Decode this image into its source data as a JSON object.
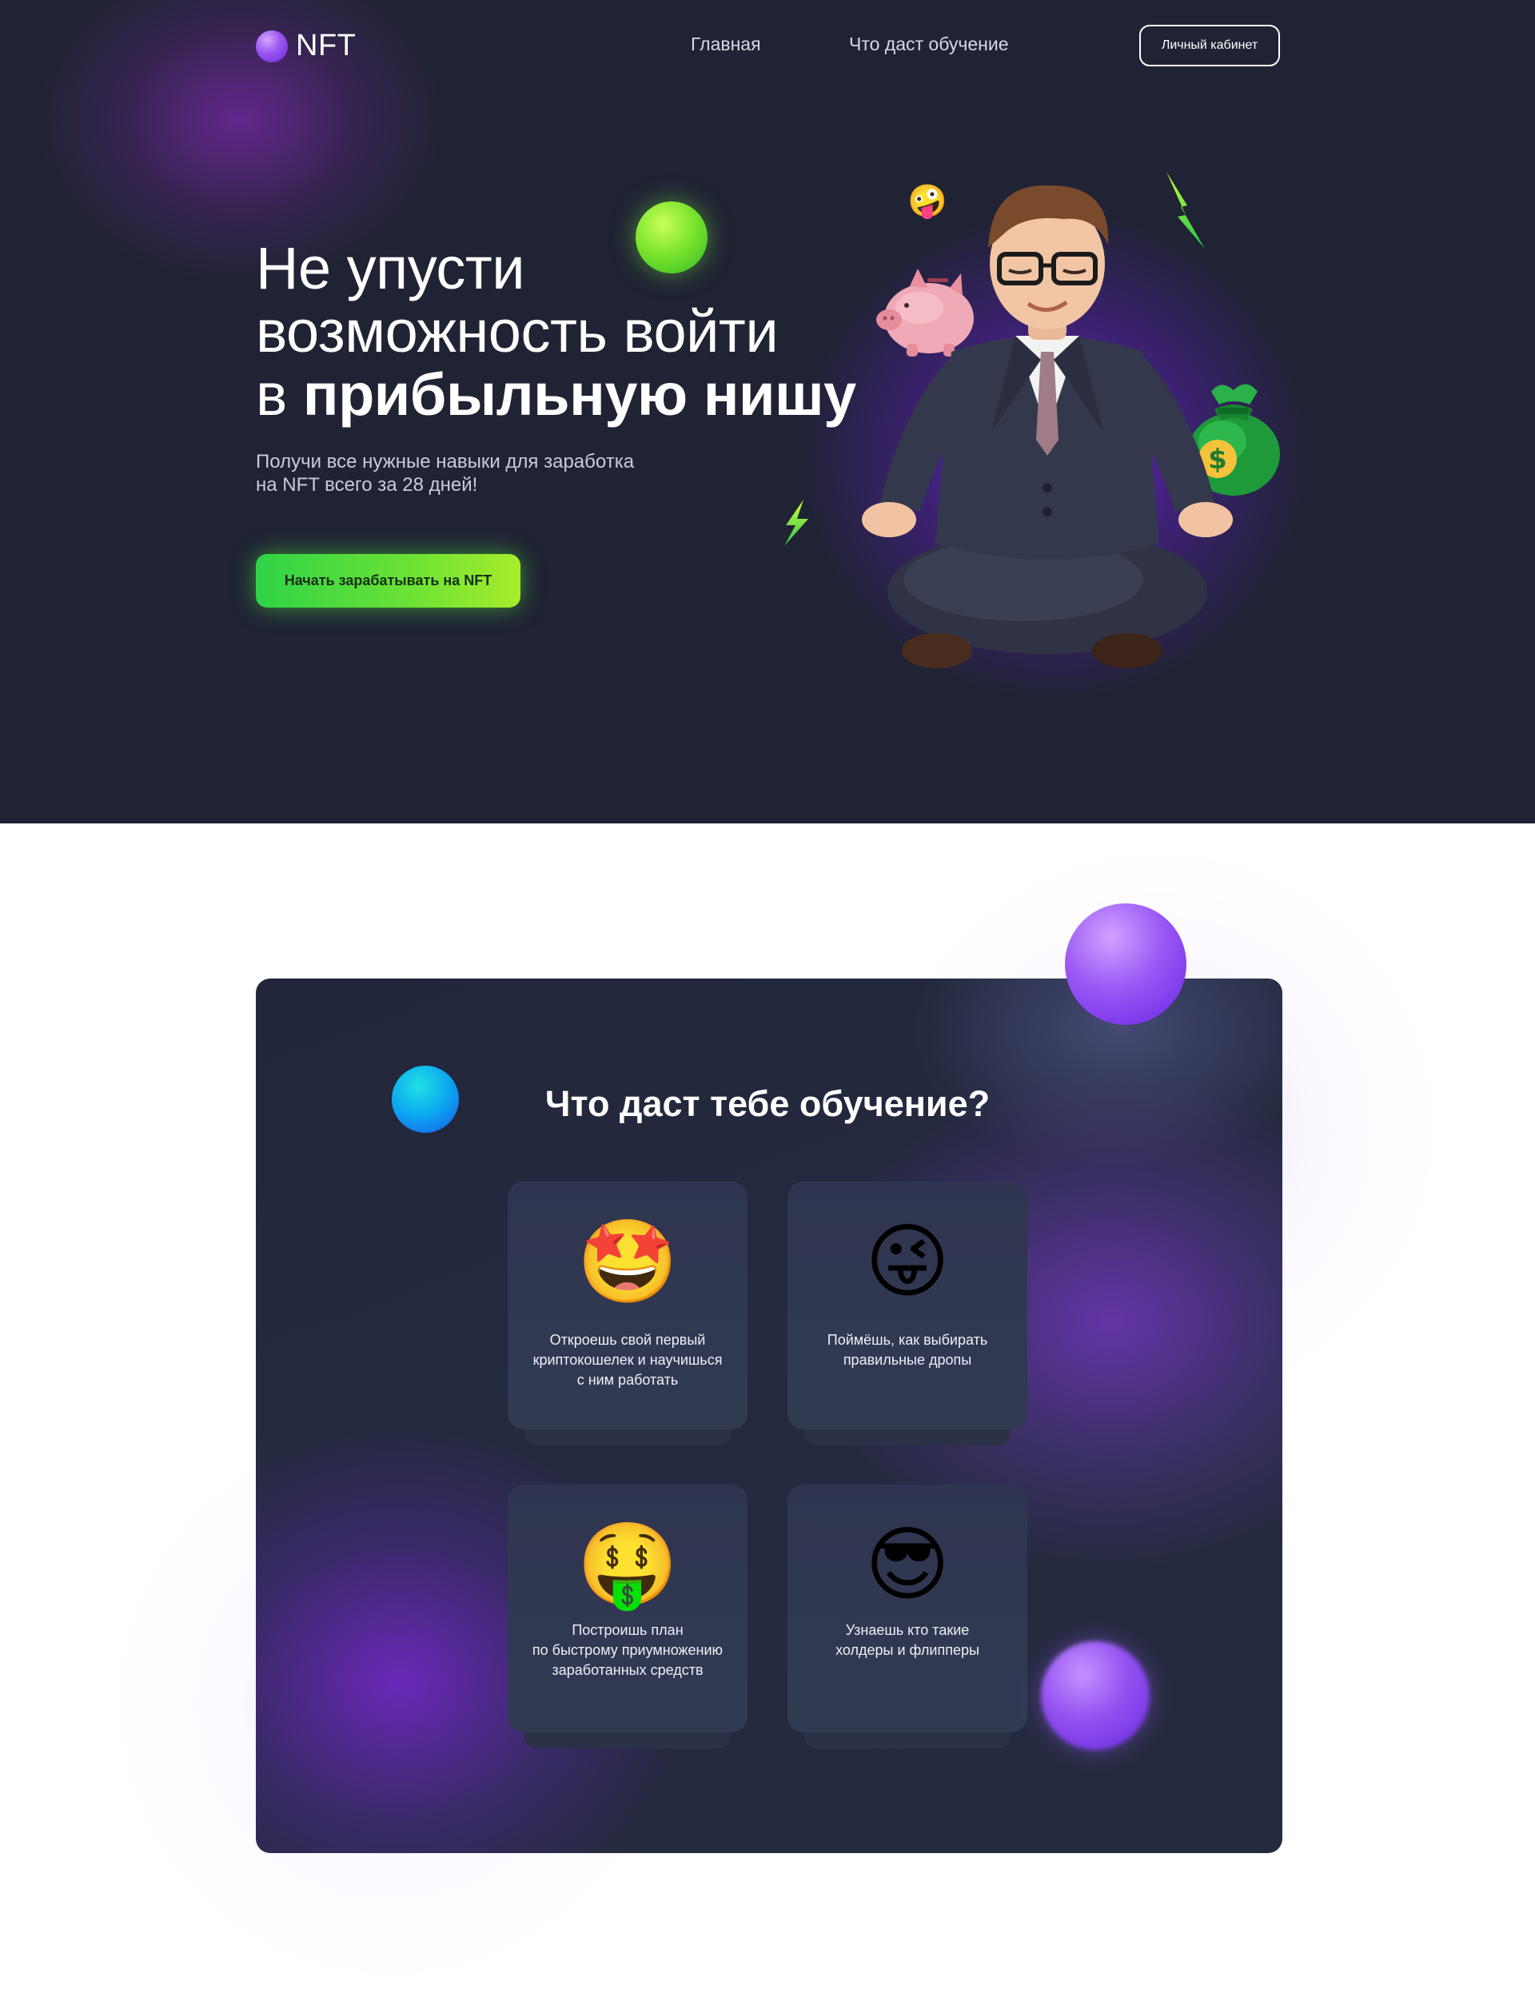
{
  "header": {
    "logo_text": "NFT",
    "nav": [
      {
        "label": "Главная"
      },
      {
        "label": "Что даст обучение"
      }
    ],
    "cabinet_label": "Личный кабинет"
  },
  "hero": {
    "title_line1": "Не упусти",
    "title_line2": "возможность войти",
    "title_line3_prefix": "в ",
    "title_line3_bold": "прибыльную нишу",
    "subtitle_line1": "Получи все нужные навыки для заработка",
    "subtitle_line2": "на NFT всего за 28 дней!",
    "cta_label": "Начать зарабатывать на NFT",
    "illustration": "meditating-businessman-3d",
    "accent_green": "#56e63c",
    "accent_purple": "#8a3ff0"
  },
  "features": {
    "title": "Что даст тебе обучение?",
    "cards": [
      {
        "icon": "star-struck-emoji",
        "glyph": "🤩",
        "lines": [
          "Откроешь свой первый",
          "криптокошелек и научишься",
          "с ним работать"
        ]
      },
      {
        "icon": "winking-tongue-emoji",
        "glyph": "😜",
        "lines": [
          "Поймёшь, как выбирать",
          "правильные дропы"
        ]
      },
      {
        "icon": "money-mouth-emoji",
        "glyph": "🤑",
        "lines": [
          "Построишь план",
          "по быстрому приумножению",
          "заработанных средств"
        ]
      },
      {
        "icon": "sunglasses-emoji",
        "glyph": "😎",
        "lines": [
          "Узнаешь кто такие",
          "холдеры и флипперы"
        ]
      }
    ]
  },
  "colors": {
    "hero_bg": "#1f2333",
    "panel_bg": "#232839",
    "card_bg": "#30374f"
  }
}
